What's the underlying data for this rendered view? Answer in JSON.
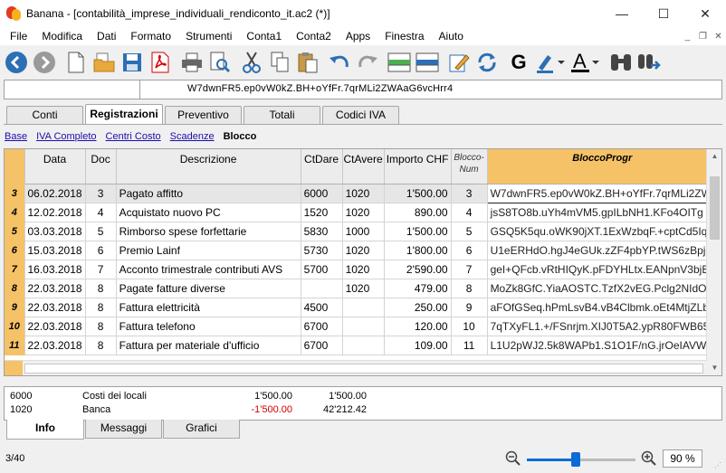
{
  "window": {
    "title": "Banana - [contabilità_imprese_individuali_rendiconto_it.ac2 (*)]",
    "minimize": "—",
    "maximize": "☐",
    "close": "✕"
  },
  "menu": [
    "File",
    "Modifica",
    "Dati",
    "Formato",
    "Strumenti",
    "Conta1",
    "Conta2",
    "Apps",
    "Finestra",
    "Aiuto"
  ],
  "mdi": {
    "minimize": "_",
    "restore": "❐",
    "close": "✕"
  },
  "toolbar_icons": [
    "back-icon",
    "forward-icon",
    "new-file-icon",
    "open-folder-icon",
    "save-icon",
    "pdf-icon",
    "print-icon",
    "print-preview-icon",
    "cut-icon",
    "copy-icon",
    "paste-icon",
    "undo-icon",
    "redo-icon",
    "add-rows-icon",
    "delete-rows-icon",
    "edit-icon",
    "recalculate-icon",
    "bold-icon",
    "highlight-icon",
    "font-color-icon",
    "binoculars-icon",
    "replace-icon"
  ],
  "toolbar_text": {
    "bold": "G",
    "font_color": "A"
  },
  "cellbar": {
    "value": "W7dwnFR5.ep0vW0kZ.BH+oYfFr.7qrMLi2ZWAaG6vcHrr4"
  },
  "tabs": [
    {
      "label": "Conti",
      "active": false
    },
    {
      "label": "Registrazioni",
      "active": true
    },
    {
      "label": "Preventivo",
      "active": false
    },
    {
      "label": "Totali",
      "active": false
    },
    {
      "label": "Codici IVA",
      "active": false
    }
  ],
  "views": [
    {
      "label": "Base",
      "current": false
    },
    {
      "label": "IVA Completo",
      "current": false
    },
    {
      "label": "Centri Costo",
      "current": false
    },
    {
      "label": "Scadenze",
      "current": false
    },
    {
      "label": "Blocco",
      "current": true
    }
  ],
  "columns": {
    "data": "Data",
    "doc": "Doc",
    "descrizione": "Descrizione",
    "ctdare": "CtDare",
    "ctavere": "CtAvere",
    "importo": "Importo CHF",
    "blocconum": "Blocco-\nNum",
    "bloccoprogr": "BloccoProgr"
  },
  "rows": [
    {
      "n": "3",
      "data": "06.02.2018",
      "doc": "3",
      "desc": "Pagato affitto",
      "dare": "6000",
      "avere": "1020",
      "importo": "1'500.00",
      "bnum": "3",
      "bprogr": "W7dwnFR5.ep0vW0kZ.BH+oYfFr.7qrMLi2ZW"
    },
    {
      "n": "4",
      "data": "12.02.2018",
      "doc": "4",
      "desc": "Acquistato nuovo PC",
      "dare": "1520",
      "avere": "1020",
      "importo": "890.00",
      "bnum": "4",
      "bprogr": "jsS8TO8b.uYh4mVM5.gpILbNH1.KFo4OITg"
    },
    {
      "n": "5",
      "data": "03.03.2018",
      "doc": "5",
      "desc": "Rimborso spese forfettarie",
      "dare": "5830",
      "avere": "1000",
      "importo": "1'500.00",
      "bnum": "5",
      "bprogr": "GSQ5K5qu.oWK90jXT.1ExWzbqF.+cptCd5Iq"
    },
    {
      "n": "6",
      "data": "15.03.2018",
      "doc": "6",
      "desc": "Premio Lainf",
      "dare": "5730",
      "avere": "1020",
      "importo": "1'800.00",
      "bnum": "6",
      "bprogr": "U1eERHdO.hgJ4eGUk.zZF4pbYP.tWS6zBpj"
    },
    {
      "n": "7",
      "data": "16.03.2018",
      "doc": "7",
      "desc": "Acconto trimestrale contributi AVS",
      "dare": "5700",
      "avere": "1020",
      "importo": "2'590.00",
      "bnum": "7",
      "bprogr": "geI+QFcb.vRtHIQyK.pFDYHLtx.EANpnV3bjB"
    },
    {
      "n": "8",
      "data": "22.03.2018",
      "doc": "8",
      "desc": "Pagate fatture diverse",
      "dare": "",
      "avere": "1020",
      "importo": "479.00",
      "bnum": "8",
      "bprogr": "MoZk8GfC.YiaAOSTC.TzfX2vEG.Pclg2NIdOy"
    },
    {
      "n": "9",
      "data": "22.03.2018",
      "doc": "8",
      "desc": "Fattura elettricità",
      "dare": "4500",
      "avere": "",
      "importo": "250.00",
      "bnum": "9",
      "bprogr": "aFOfGSeq.hPmLsvB4.vB4Clbmk.oEt4MtjZLbv"
    },
    {
      "n": "10",
      "data": "22.03.2018",
      "doc": "8",
      "desc": "Fattura telefono",
      "dare": "6700",
      "avere": "",
      "importo": "120.00",
      "bnum": "10",
      "bprogr": "7qTXyFL1.+/FSnrjm.XIJ0T5A2.ypR80FWB65"
    },
    {
      "n": "11",
      "data": "22.03.2018",
      "doc": "8",
      "desc": "Fattura per materiale d'ufficio",
      "dare": "6700",
      "avere": "",
      "importo": "109.00",
      "bnum": "11",
      "bprogr": "L1U2pWJ2.5k8WAPb1.S1O1F/nG.jrOeIAVW"
    }
  ],
  "info": [
    {
      "account": "6000",
      "desc": "Costi dei locali",
      "amount": "1'500.00",
      "balance": "1'500.00",
      "negative": false
    },
    {
      "account": "1020",
      "desc": "Banca",
      "amount": "-1'500.00",
      "balance": "42'212.42",
      "negative": true
    }
  ],
  "bottom_tabs": [
    {
      "label": "Info",
      "active": true
    },
    {
      "label": "Messaggi",
      "active": false
    },
    {
      "label": "Grafici",
      "active": false
    }
  ],
  "status": {
    "counter": "3/40",
    "zoom": "90 %",
    "zoom_level_percent": 90
  },
  "colors": {
    "accent": "#f6c267",
    "link": "#1a0dab",
    "negative": "#d00000",
    "slider": "#0a6bd6"
  }
}
